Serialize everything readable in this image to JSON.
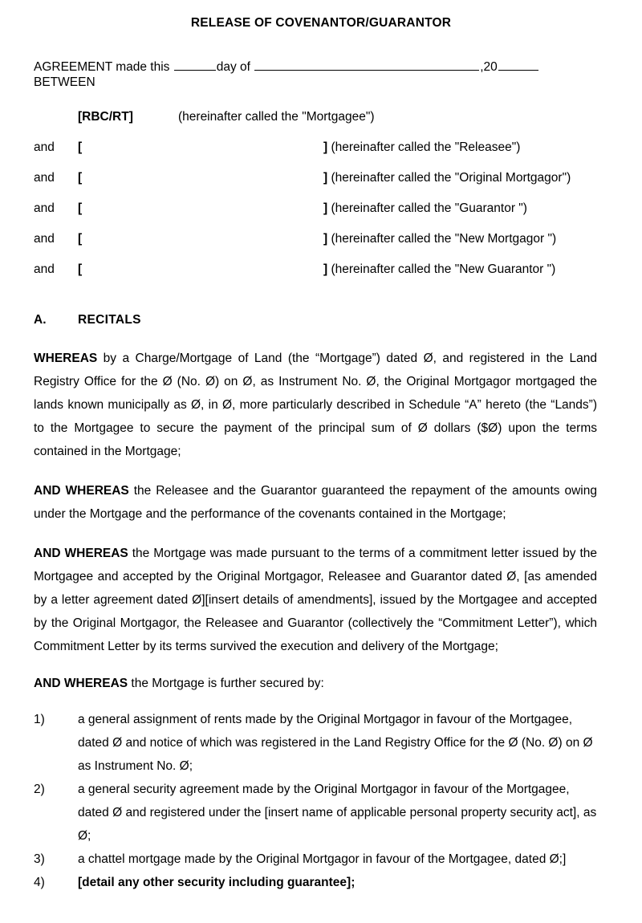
{
  "document": {
    "title": "RELEASE OF COVENANTOR/GUARANTOR",
    "agreement": {
      "lead": "AGREEMENT made this ",
      "day_word": "day of ",
      "year_prefix": ",20",
      "between": "BETWEEN"
    },
    "parties": [
      {
        "and": "",
        "name": "[RBC/RT]",
        "close": " (hereinafter called the \"Mortgagee\")"
      },
      {
        "and": "and",
        "name": "[",
        "close_bracket": "]",
        "close": " (hereinafter called the \"Releasee\")"
      },
      {
        "and": "and",
        "name": "[",
        "close_bracket": "]",
        "close": " (hereinafter called the \"Original Mortgagor\")"
      },
      {
        "and": "and",
        "name": "[",
        "close_bracket": "]",
        "close": " (hereinafter called the \"Guarantor \")"
      },
      {
        "and": "and",
        "name": "[",
        "close_bracket": "]",
        "close": " (hereinafter called the \"New Mortgagor \")"
      },
      {
        "and": "and",
        "name": "[",
        "close_bracket": "]",
        "close": " (hereinafter called the \"New Guarantor \")"
      }
    ],
    "section_a": {
      "letter": "A.",
      "title": "RECITALS"
    },
    "recitals": [
      {
        "lead": "WHEREAS",
        "body": " by a Charge/Mortgage of Land (the “Mortgage”) dated Ø, and registered in the Land Registry Office for the Ø (No. Ø) on Ø, as Instrument No. Ø, the Original Mortgagor mortgaged the lands known municipally as Ø, in Ø, more particularly described in Schedule “A” hereto (the “Lands”) to the Mortgagee to secure the payment of the principal sum of Ø dollars ($Ø) upon the terms contained in the Mortgage;"
      },
      {
        "lead": "AND WHEREAS",
        "body": " the Releasee and the Guarantor guaranteed the repayment of the amounts owing under the Mortgage and the performance of the covenants contained in the Mortgage;"
      },
      {
        "lead": "AND WHEREAS",
        "body": " the Mortgage was made pursuant to the terms of a commitment letter issued by the Mortgagee and accepted by the Original Mortgagor, Releasee and Guarantor dated Ø, [as amended by a letter agreement dated Ø][insert details of amendments], issued by the Mortgagee and accepted by the Original Mortgagor, the Releasee and Guarantor (collectively the “Commitment Letter”), which Commitment Letter by its terms survived the execution and delivery of the Mortgage;"
      },
      {
        "lead": "AND WHEREAS",
        "body": " the Mortgage is further secured by:"
      }
    ],
    "security_list": [
      {
        "num": "1)",
        "text": "a general assignment of rents made by the Original Mortgagor in favour of the Mortgagee, dated Ø and notice of which was registered in the Land Registry Office for the Ø (No. Ø) on Ø as Instrument No. Ø;",
        "bold": false
      },
      {
        "num": "2)",
        "text": "a general security agreement made by the Original Mortgagor in favour of the Mortgagee, dated Ø and registered under the [insert name of applicable personal property security act], as Ø;",
        "bold": false
      },
      {
        "num": "3)",
        "text": "a chattel mortgage made by the Original Mortgagor in favour of the Mortgagee, dated Ø;]",
        "bold": false
      },
      {
        "num": "4)",
        "text": "[detail any other security including guarantee];",
        "bold": true
      }
    ]
  }
}
